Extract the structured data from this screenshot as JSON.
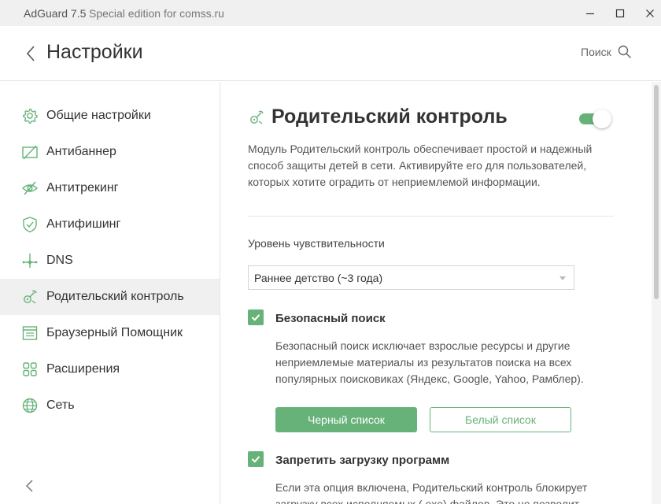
{
  "window": {
    "app_title": "AdGuard 7.5",
    "edition": "Special edition for comss.ru"
  },
  "header": {
    "title": "Настройки",
    "search_label": "Поиск"
  },
  "sidebar": {
    "items": [
      {
        "label": "Общие настройки",
        "icon": "gear-icon"
      },
      {
        "label": "Антибаннер",
        "icon": "antibanner-icon"
      },
      {
        "label": "Антитрекинг",
        "icon": "antitracking-eye-icon"
      },
      {
        "label": "Антифишинг",
        "icon": "shield-check-icon"
      },
      {
        "label": "DNS",
        "icon": "dns-network-icon"
      },
      {
        "label": "Родительский контроль",
        "icon": "parental-control-icon",
        "active": true
      },
      {
        "label": "Браузерный Помощник",
        "icon": "browser-assistant-icon"
      },
      {
        "label": "Расширения",
        "icon": "extensions-grid-icon"
      },
      {
        "label": "Сеть",
        "icon": "globe-icon"
      }
    ]
  },
  "content": {
    "title": "Родительский контроль",
    "enabled": true,
    "description": "Модуль Родительский контроль обеспечивает простой и надежный способ защиты детей в сети. Активируйте его для пользователей, которых хотите оградить от неприемлемой информации.",
    "sensitivity": {
      "label": "Уровень чувствительности",
      "selected": "Раннее детство (~3 года)"
    },
    "safe_search": {
      "checked": true,
      "title": "Безопасный поиск",
      "description": "Безопасный поиск исключает взрослые ресурсы и другие неприемлемые материалы из результатов поиска на всех популярных поисковиках (Яндекс, Google, Yahoo, Рамблер).",
      "blacklist_label": "Черный список",
      "whitelist_label": "Белый список"
    },
    "block_downloads": {
      "checked": true,
      "title": "Запретить загрузку программ",
      "description": "Если эта опция включена, Родительский контроль блокирует загрузку всех исполняемых (.exe) файлов. Это не позволит"
    }
  },
  "colors": {
    "accent": "#67b279",
    "titlebar_bg": "#f0f0f0",
    "active_item_bg": "#f0f0f0"
  }
}
